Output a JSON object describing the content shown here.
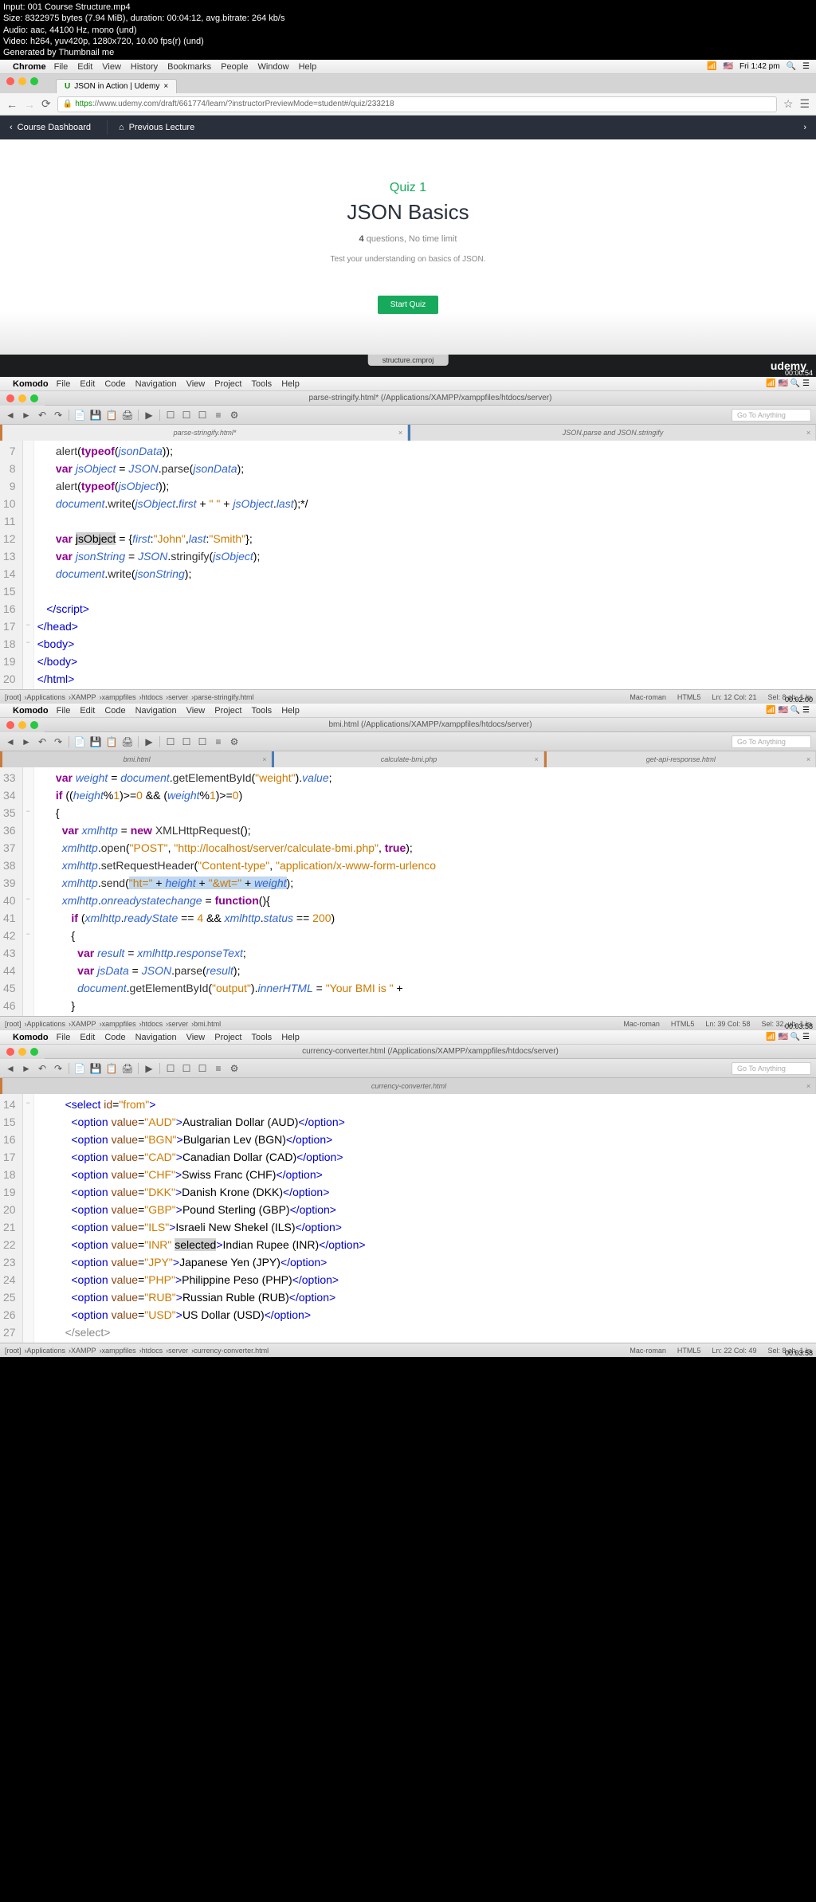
{
  "video": {
    "input": "Input: 001 Course Structure.mp4",
    "size": "Size: 8322975 bytes (7.94 MiB), duration: 00:04:12, avg.bitrate: 264 kb/s",
    "audio": "Audio: aac, 44100 Hz, mono (und)",
    "video_line": "Video: h264, yuv420p, 1280x720, 10.00 fps(r) (und)",
    "gen": "Generated by Thumbnail me"
  },
  "mac1": {
    "app": "Chrome",
    "menus": [
      "File",
      "Edit",
      "View",
      "History",
      "Bookmarks",
      "People",
      "Window",
      "Help"
    ],
    "clock": "Fri 1:42 pm"
  },
  "chrome": {
    "tab": "JSON in Action | Udemy",
    "https": "https",
    "url": "://www.udemy.com/draft/661774/learn/?instructorPreviewMode=student#/quiz/233218"
  },
  "udemy": {
    "dashboard": "Course Dashboard",
    "prev": "Previous Lecture",
    "quiz_num": "Quiz 1",
    "quiz_title": "JSON Basics",
    "q_count": "4",
    "q_meta": " questions, No time limit",
    "desc": "Test your understanding on basics of JSON.",
    "start": "Start Quiz",
    "logo": "udemy",
    "ts": "00:00:54",
    "structure": "structure.cmproj"
  },
  "komodo_menu": {
    "app": "Komodo",
    "menus": [
      "File",
      "Edit",
      "Code",
      "Navigation",
      "View",
      "Project",
      "Tools",
      "Help"
    ]
  },
  "k1": {
    "title": "parse-stringify.html* (/Applications/XAMPP/xamppfiles/htdocs/server)",
    "search": "Go To Anything",
    "tab1": "parse-stringify.html*",
    "tab2": "JSON.parse and JSON.stringify",
    "status_crumbs": [
      "[root]",
      "Applications",
      "XAMPP",
      "xamppfiles",
      "htdocs",
      "server",
      "parse-stringify.html"
    ],
    "status_r": [
      "Mac-roman",
      "HTML5",
      "Ln: 12 Col: 21",
      "Sel: 8 ch, 1 ln"
    ],
    "ts": "00:02:00"
  },
  "k2": {
    "title": "bmi.html (/Applications/XAMPP/xamppfiles/htdocs/server)",
    "tab1": "bmi.html",
    "tab2": "calculate-bmi.php",
    "tab3": "get-api-response.html",
    "status_crumbs": [
      "[root]",
      "Applications",
      "XAMPP",
      "xamppfiles",
      "htdocs",
      "server",
      "bmi.html"
    ],
    "status_r": [
      "Mac-roman",
      "HTML5",
      "Ln: 39 Col: 58",
      "Sel: 32, uh, 1 ln"
    ],
    "ts": "00:03:58"
  },
  "k3": {
    "title": "currency-converter.html (/Applications/XAMPP/xamppfiles/htdocs/server)",
    "tab1": "currency-converter.html",
    "status_crumbs": [
      "[root]",
      "Applications",
      "XAMPP",
      "xamppfiles",
      "htdocs",
      "server",
      "currency-converter.html"
    ],
    "status_r": [
      "Mac-roman",
      "HTML5",
      "Ln: 22 Col: 49",
      "Sel: 8 ch, 1 ln"
    ],
    "ts": "00:03:58"
  }
}
